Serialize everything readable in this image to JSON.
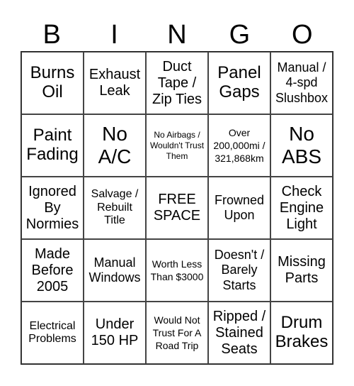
{
  "header": {
    "letters": [
      "B",
      "I",
      "N",
      "G",
      "O"
    ]
  },
  "board": {
    "rows": [
      [
        "Burns Oil",
        "Exhaust Leak",
        "Duct Tape / Zip Ties",
        "Panel Gaps",
        "Manual / 4-spd Slushbox"
      ],
      [
        "Paint Fading",
        "No A/C",
        "No Airbags / Wouldn't Trust Them",
        "Over 200,000mi / 321,868km",
        "No ABS"
      ],
      [
        "Ignored By Normies",
        "Salvage / Rebuilt Title",
        "FREE SPACE",
        "Frowned Upon",
        "Check Engine Light"
      ],
      [
        "Made Before 2005",
        "Manual Windows",
        "Worth Less Than $3000",
        "Doesn't / Barely Starts",
        "Missing Parts"
      ],
      [
        "Electrical Problems",
        "Under 150 HP",
        "Would Not Trust For A Road Trip",
        "Ripped / Stained Seats",
        "Drum Brakes"
      ]
    ]
  }
}
